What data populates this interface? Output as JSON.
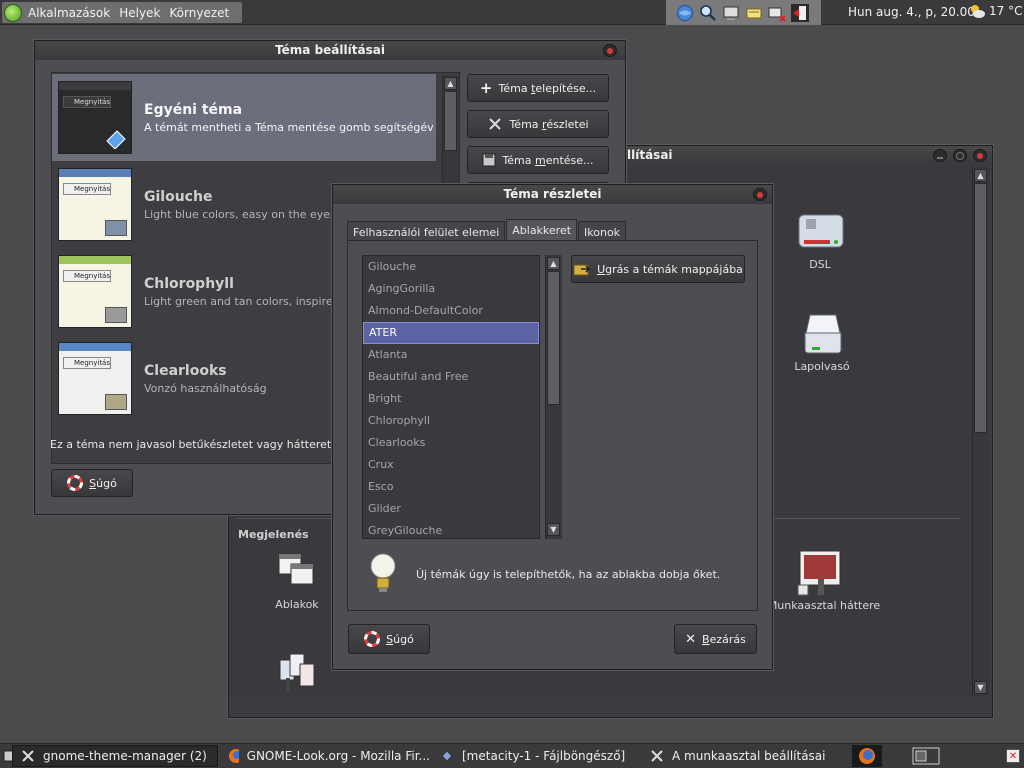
{
  "top_panel": {
    "menus": [
      "Alkalmazások",
      "Helyek",
      "Környezet"
    ],
    "clock": "Hun aug. 4., p, 20.00",
    "temperature": "17 °C"
  },
  "main_window": {
    "title": "Téma beállításai",
    "themes": [
      {
        "name": "Egyéni téma",
        "description": "A témát mentheti a Téma mentése gomb segítségével.",
        "thumb_button": "Megnyitás",
        "selected": true
      },
      {
        "name": "Gilouche",
        "description": "Light blue colors, easy on the eyes",
        "thumb_button": "Megnyitás",
        "selected": false
      },
      {
        "name": "Chlorophyll",
        "description": "Light green and tan colors, inspired by nature",
        "thumb_button": "Megnyitás",
        "selected": false
      },
      {
        "name": "Clearlooks",
        "description": "Vonzó használhatóság",
        "thumb_button": "Megnyitás",
        "selected": false
      }
    ],
    "buttons": {
      "install": {
        "pre": "Téma ",
        "ul": "t",
        "post": "elepítése..."
      },
      "details": {
        "pre": "Téma ",
        "ul": "r",
        "post": "észletei"
      },
      "save": {
        "pre": "Téma ",
        "ul": "m",
        "post": "entése..."
      }
    },
    "notice": "Ez a téma nem javasol betűkészletet vagy hátteret.",
    "help": {
      "ul": "S",
      "post": "úgó"
    }
  },
  "back_window": {
    "title_fragment": "llításai",
    "icons": {
      "dsl": "DSL",
      "scanner": "Lapolvasó",
      "windows": "Ablakok",
      "wallpaper": "Munkaasztal háttere"
    },
    "section": "Megjelenés"
  },
  "details_dialog": {
    "title": "Téma részletei",
    "tabs": [
      "Felhasználói felület elemei",
      "Ablakkeret",
      "Ikonok"
    ],
    "active_tab": 1,
    "window_borders": [
      "Gilouche",
      "AgingGorilla",
      "Almond-DefaultColor",
      "ATER",
      "Atlanta",
      "Beautiful and Free",
      "Bright",
      "Chlorophyll",
      "Clearlooks",
      "Crux",
      "Esco",
      "Glider",
      "GreyGilouche"
    ],
    "selected": "ATER",
    "goto_folder": {
      "ul": "U",
      "post": "grás a témák mappájába"
    },
    "hint": "Új témák úgy is telepíthetők, ha az ablakba dobja őket.",
    "help": {
      "ul": "S",
      "post": "úgó"
    },
    "close": {
      "ul": "B",
      "post": "ezárás"
    }
  },
  "taskbar": {
    "tasks": [
      "gnome-theme-manager (2)",
      "GNOME-Look.org - Mozilla Fir...",
      "[metacity-1 - Fájlböngésző]",
      "A munkaasztal beállításai"
    ]
  }
}
